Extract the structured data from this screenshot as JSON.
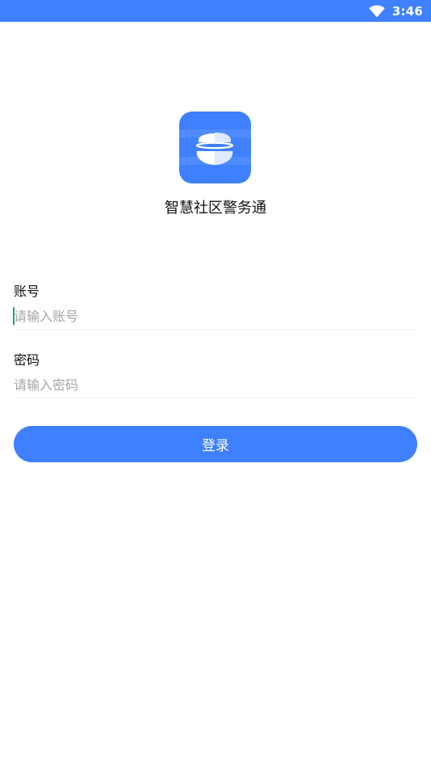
{
  "status_bar": {
    "time": "3:46",
    "wifi_icon": "wifi-icon",
    "background": "#3f80ff"
  },
  "app": {
    "name": "智慧社区警务通",
    "logo_icon": "app-logo-icon",
    "logo_color": "#3f80ff"
  },
  "login_form": {
    "account": {
      "label": "账号",
      "placeholder": "请输入账号",
      "value": ""
    },
    "password": {
      "label": "密码",
      "placeholder": "请输入密码",
      "value": ""
    },
    "submit_label": "登录",
    "accent_color": "#3f80ff"
  }
}
